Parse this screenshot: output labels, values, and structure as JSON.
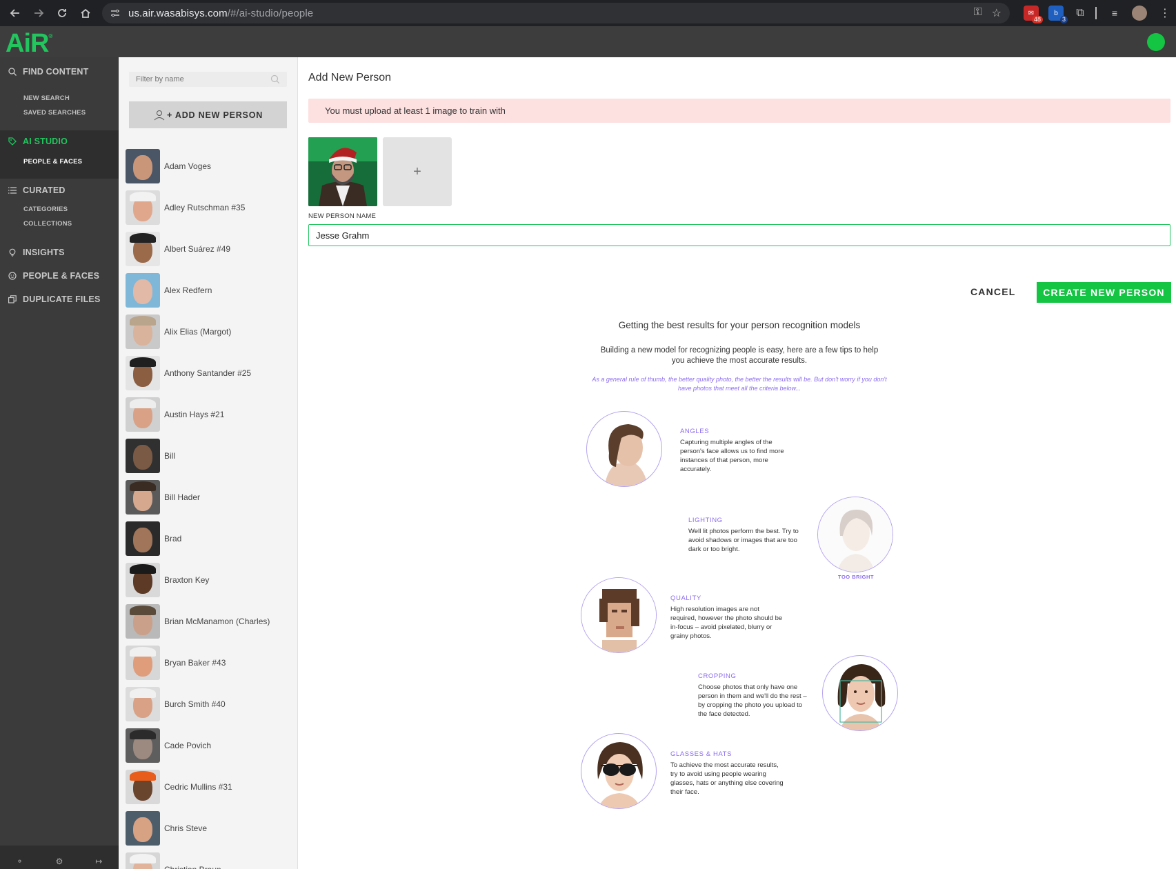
{
  "browser": {
    "url_host": "us.air.wasabisys.com",
    "url_path": "/#/ai-studio/people",
    "ext_badge_1": "48",
    "ext_badge_2": "3"
  },
  "header": {
    "logo_text": "AiR",
    "logo_mark": "®"
  },
  "leftnav": {
    "find_content": "FIND CONTENT",
    "new_search": "NEW SEARCH",
    "saved_searches": "SAVED SEARCHES",
    "ai_studio": "AI STUDIO",
    "people_faces_sub": "PEOPLE & FACES",
    "curated": "CURATED",
    "categories": "CATEGORIES",
    "collections": "COLLECTIONS",
    "insights": "INSIGHTS",
    "people_faces": "PEOPLE & FACES",
    "duplicate_files": "DUPLICATE FILES"
  },
  "people_panel": {
    "filter_placeholder": "Filter by name",
    "add_button": "+ ADD NEW PERSON",
    "people": [
      {
        "name": "Adam Voges",
        "skin": "#c9967a",
        "bg": "#4a5565",
        "cap": ""
      },
      {
        "name": "Adley Rutschman #35",
        "skin": "#e0a78c",
        "bg": "#dcdcdc",
        "cap": "#f2f2f2"
      },
      {
        "name": "Albert Suárez #49",
        "skin": "#9a6a4b",
        "bg": "#e6e6e6",
        "cap": "#222222"
      },
      {
        "name": "Alex Redfern",
        "skin": "#e2b8a6",
        "bg": "#7fb7d9",
        "cap": ""
      },
      {
        "name": "Alix Elias (Margot)",
        "skin": "#d9b39c",
        "bg": "#c9c9c9",
        "cap": "#b9a48c"
      },
      {
        "name": "Anthony Santander #25",
        "skin": "#8b5e42",
        "bg": "#e4e4e4",
        "cap": "#1f1f1f"
      },
      {
        "name": "Austin Hays #21",
        "skin": "#d9a186",
        "bg": "#d0d0d0",
        "cap": "#ededed"
      },
      {
        "name": "Bill",
        "skin": "#7a5a45",
        "bg": "#303030",
        "cap": ""
      },
      {
        "name": "Bill Hader",
        "skin": "#d6a98f",
        "bg": "#5a5a5a",
        "cap": "#3a2c22"
      },
      {
        "name": "Brad",
        "skin": "#a0755a",
        "bg": "#2a2a2a",
        "cap": ""
      },
      {
        "name": "Braxton Key",
        "skin": "#5c3a26",
        "bg": "#d9d9d9",
        "cap": "#1a1a1a"
      },
      {
        "name": "Brian McManamon (Charles)",
        "skin": "#caa08a",
        "bg": "#b9b9b9",
        "cap": "#5a4a3a"
      },
      {
        "name": "Bryan Baker #43",
        "skin": "#e09d7c",
        "bg": "#d7d7d7",
        "cap": "#f0f0f0"
      },
      {
        "name": "Burch Smith #40",
        "skin": "#d9a286",
        "bg": "#dcdcdc",
        "cap": "#f0f0f0"
      },
      {
        "name": "Cade Povich",
        "skin": "#9c8a80",
        "bg": "#5e5e5e",
        "cap": "#2b2b2b"
      },
      {
        "name": "Cedric Mullins #31",
        "skin": "#6a452e",
        "bg": "#d9d9d9",
        "cap": "#e85c1c"
      },
      {
        "name": "Chris Steve",
        "skin": "#d7a184",
        "bg": "#4e5d6a",
        "cap": ""
      },
      {
        "name": "Christian Braun",
        "skin": "#e0b39a",
        "bg": "#d6d6d6",
        "cap": "#f2f2f2"
      }
    ]
  },
  "main": {
    "title": "Add New Person",
    "alert": "You must upload at least 1 image to train with",
    "name_label": "NEW PERSON NAME",
    "name_value": "Jesse Grahm",
    "cancel": "CANCEL",
    "create": "CREATE NEW PERSON",
    "tips_title": "Getting the best results for your person recognition models",
    "tips_intro": "Building a new model for recognizing people is easy, here are a few tips to help you achieve the most accurate results.",
    "tips_note": "As a general rule of thumb, the better quality photo, the better the results will be. But don't worry if you don't have photos that meet all the criteria below...",
    "tips": {
      "angles_title": "ANGLES",
      "angles_text": "Capturing multiple angles of the person's face allows us to find more instances of that person, more accurately.",
      "lighting_title": "LIGHTING",
      "lighting_text": "Well lit photos perform the best. Try to avoid shadows or images that are too dark or too bright.",
      "lighting_caption": "TOO BRIGHT",
      "quality_title": "QUALITY",
      "quality_text": "High resolution images are not required, however the photo should be in-focus – avoid pixelated, blurry or grainy photos.",
      "cropping_title": "CROPPING",
      "cropping_text": "Choose photos that only have one person in them and we'll do the rest – by cropping the photo you upload to the face detected.",
      "glasses_title": "GLASSES & HATS",
      "glasses_text": "To achieve the most accurate results, try to avoid using people wearing glasses, hats or anything else covering their face."
    }
  },
  "colors": {
    "brand_green": "#22c55e",
    "button_green": "#14c443",
    "tip_purple": "#8b6cf0",
    "alert_bg": "#fde0e0"
  }
}
